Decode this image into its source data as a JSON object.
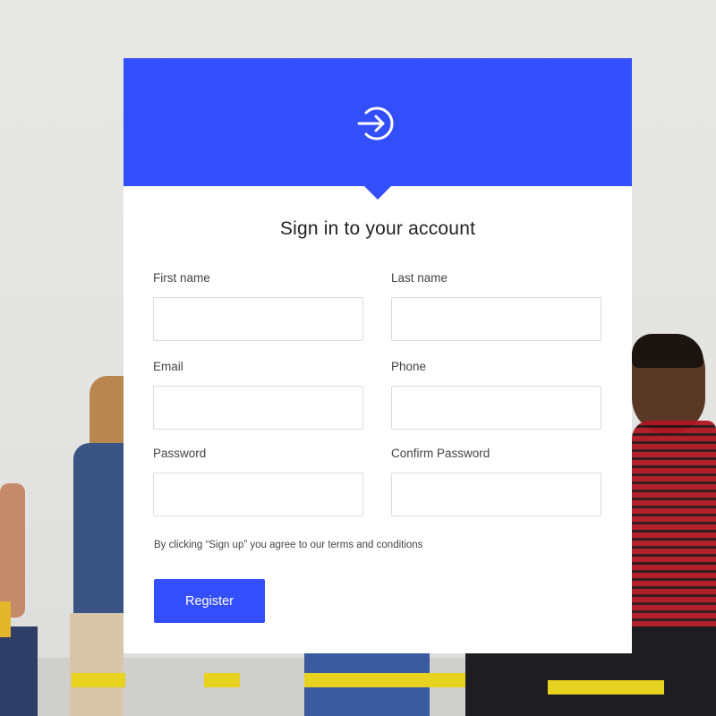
{
  "form": {
    "title": "Sign in to your account",
    "fields": [
      {
        "label": "First name",
        "value": "",
        "placeholder": ""
      },
      {
        "label": "Last name",
        "value": "",
        "placeholder": ""
      },
      {
        "label": "Email",
        "value": "",
        "placeholder": ""
      },
      {
        "label": "Phone",
        "value": "",
        "placeholder": ""
      },
      {
        "label": "Password",
        "value": "",
        "placeholder": ""
      },
      {
        "label": "Confirm Password",
        "value": "",
        "placeholder": ""
      }
    ],
    "terms": "By clicking “Sign up” you agree to our terms and conditions",
    "submit_label": "Register",
    "header_icon": "login-arrow-circle-icon"
  },
  "colors": {
    "accent": "#334ffb",
    "card": "#ffffff",
    "background": "#e4e4e2"
  }
}
